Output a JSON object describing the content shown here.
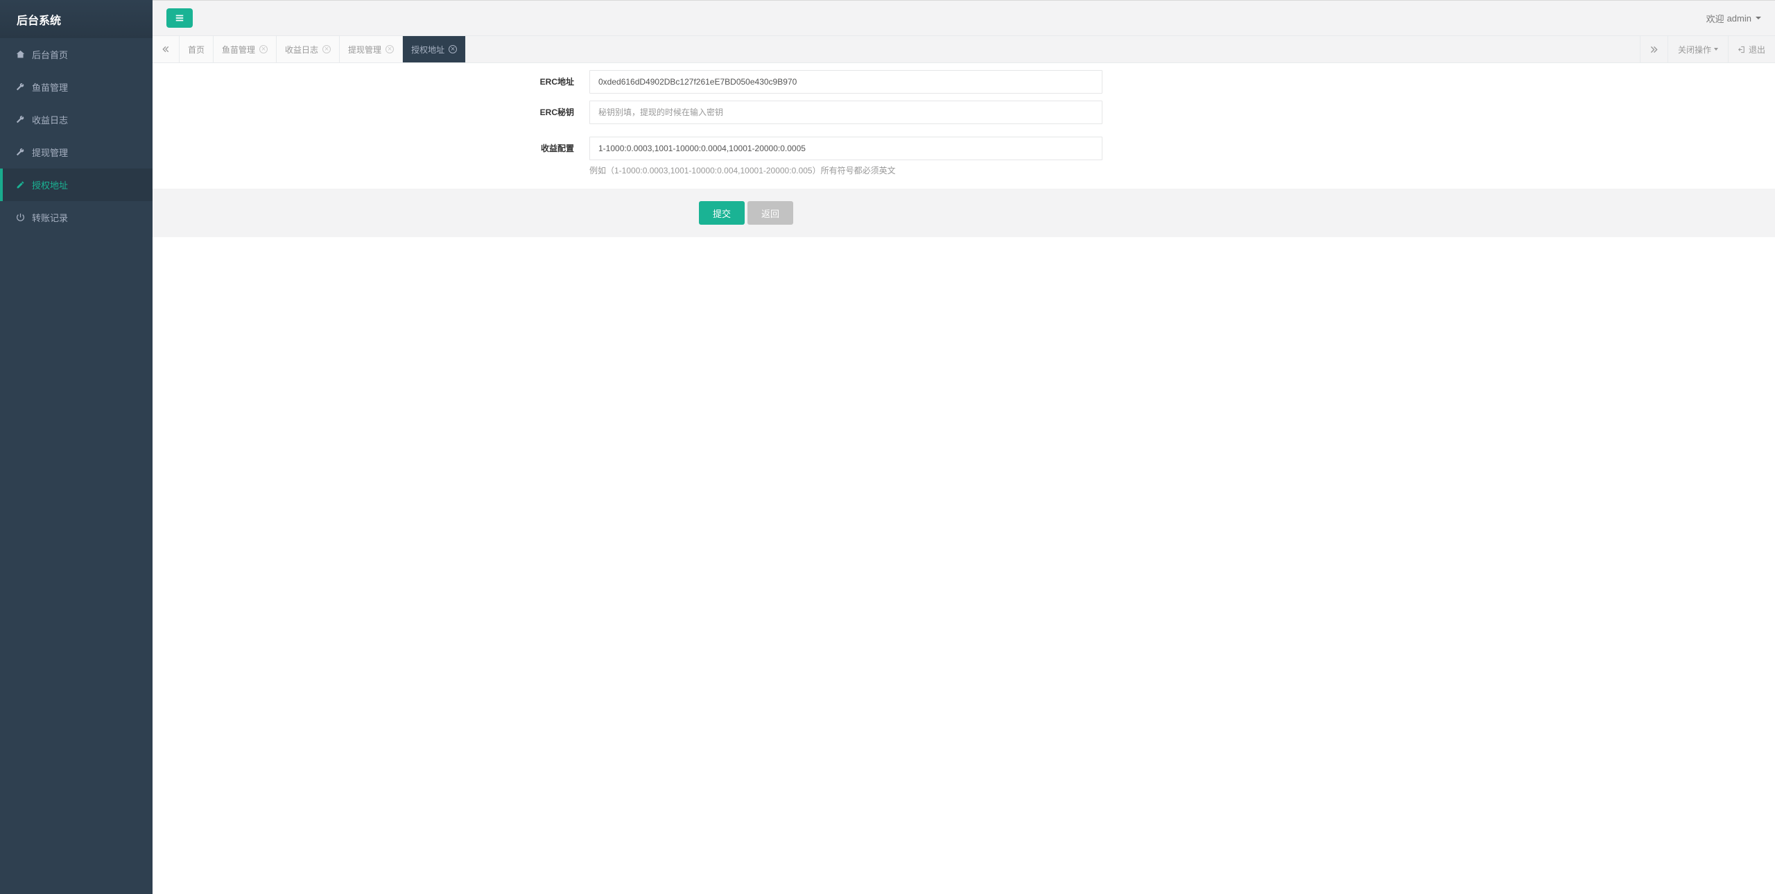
{
  "sidebar": {
    "title": "后台系统",
    "items": [
      {
        "label": "后台首页",
        "icon": "home"
      },
      {
        "label": "鱼苗管理",
        "icon": "wrench"
      },
      {
        "label": "收益日志",
        "icon": "wrench"
      },
      {
        "label": "提现管理",
        "icon": "wrench"
      },
      {
        "label": "授权地址",
        "icon": "edit"
      },
      {
        "label": "转账记录",
        "icon": "power"
      }
    ]
  },
  "topbar": {
    "welcome_prefix": "欢迎",
    "username": "admin"
  },
  "tabs": {
    "items": [
      {
        "label": "首页",
        "closable": false
      },
      {
        "label": "鱼苗管理",
        "closable": true
      },
      {
        "label": "收益日志",
        "closable": true
      },
      {
        "label": "提现管理",
        "closable": true
      },
      {
        "label": "授权地址",
        "closable": true
      }
    ],
    "close_ops_label": "关闭操作",
    "exit_label": "退出"
  },
  "form": {
    "erc_address": {
      "label": "ERC地址",
      "value": "0xded616dD4902DBc127f261eE7BD050e430c9B970"
    },
    "erc_secret": {
      "label": "ERC秘钥",
      "placeholder": "秘钥别填，提现的时候在输入密钥"
    },
    "profit_config": {
      "label": "收益配置",
      "value": "1-1000:0.0003,1001-10000:0.0004,10001-20000:0.0005",
      "help": "例如（1-1000:0.0003,1001-10000:0.004,10001-20000:0.005）所有符号都必须英文"
    },
    "submit_label": "提交",
    "back_label": "返回"
  }
}
